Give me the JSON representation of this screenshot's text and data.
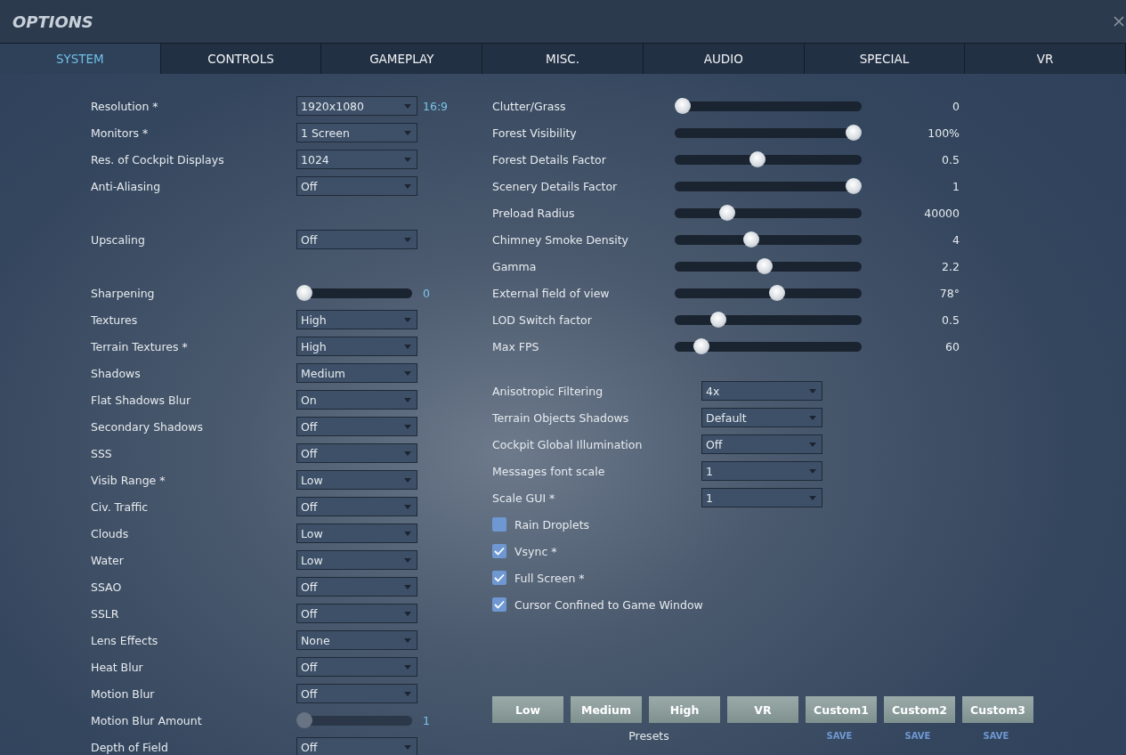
{
  "window": {
    "title": "OPTIONS"
  },
  "tabs": [
    {
      "label": "SYSTEM",
      "selected": true
    },
    {
      "label": "CONTROLS",
      "selected": false
    },
    {
      "label": "GAMEPLAY",
      "selected": false
    },
    {
      "label": "MISC.",
      "selected": false
    },
    {
      "label": "AUDIO",
      "selected": false
    },
    {
      "label": "SPECIAL",
      "selected": false
    },
    {
      "label": "VR",
      "selected": false
    }
  ],
  "left_settings": [
    {
      "kind": "dropdown",
      "label": "Resolution *",
      "value": "1920x1080",
      "note": "16:9"
    },
    {
      "kind": "dropdown",
      "label": "Monitors *",
      "value": "1 Screen"
    },
    {
      "kind": "dropdown",
      "label": "Res. of Cockpit Displays",
      "value": "1024"
    },
    {
      "kind": "dropdown",
      "label": "Anti-Aliasing",
      "value": "Off"
    },
    {
      "kind": "spacer"
    },
    {
      "kind": "dropdown",
      "label": "Upscaling",
      "value": "Off"
    },
    {
      "kind": "spacer"
    },
    {
      "kind": "slider",
      "label": "Sharpening",
      "level": 0,
      "reading": "0",
      "disabled": false
    },
    {
      "kind": "dropdown",
      "label": "Textures",
      "value": "High"
    },
    {
      "kind": "dropdown",
      "label": "Terrain Textures *",
      "value": "High"
    },
    {
      "kind": "dropdown",
      "label": "Shadows",
      "value": "Medium"
    },
    {
      "kind": "dropdown",
      "label": "Flat Shadows Blur",
      "value": "On"
    },
    {
      "kind": "dropdown",
      "label": "Secondary Shadows",
      "value": "Off"
    },
    {
      "kind": "dropdown",
      "label": "SSS",
      "value": "Off"
    },
    {
      "kind": "dropdown",
      "label": "Visib Range *",
      "value": "Low"
    },
    {
      "kind": "dropdown",
      "label": "Civ. Traffic",
      "value": "Off"
    },
    {
      "kind": "dropdown",
      "label": "Clouds",
      "value": "Low"
    },
    {
      "kind": "dropdown",
      "label": "Water",
      "value": "Low"
    },
    {
      "kind": "dropdown",
      "label": "SSAO",
      "value": "Off"
    },
    {
      "kind": "dropdown",
      "label": "SSLR",
      "value": "Off"
    },
    {
      "kind": "dropdown",
      "label": "Lens Effects",
      "value": "None"
    },
    {
      "kind": "dropdown",
      "label": "Heat Blur",
      "value": "Off"
    },
    {
      "kind": "dropdown",
      "label": "Motion Blur",
      "value": "Off"
    },
    {
      "kind": "slider",
      "label": "Motion Blur Amount",
      "level": 0,
      "reading": "1",
      "disabled": true
    },
    {
      "kind": "dropdown",
      "label": "Depth of Field",
      "value": "Off"
    }
  ],
  "right_sliders": [
    {
      "label": "Clutter/Grass",
      "level": 0,
      "reading": "0"
    },
    {
      "label": "Forest Visibility",
      "level": 1,
      "reading": "100%"
    },
    {
      "label": "Forest Details Factor",
      "level": 0.44,
      "reading": "0.5"
    },
    {
      "label": "Scenery Details Factor",
      "level": 1,
      "reading": "1"
    },
    {
      "label": "Preload Radius",
      "level": 0.26,
      "reading": "40000"
    },
    {
      "label": "Chimney Smoke Density",
      "level": 0.4,
      "reading": "4"
    },
    {
      "label": "Gamma",
      "level": 0.48,
      "reading": "2.2"
    },
    {
      "label": "External field of view",
      "level": 0.55,
      "reading": "78°"
    },
    {
      "label": "LOD Switch factor",
      "level": 0.21,
      "reading": "0.5"
    },
    {
      "label": "Max FPS",
      "level": 0.11,
      "reading": "60"
    }
  ],
  "right_dropdowns": [
    {
      "label": "Anisotropic Filtering",
      "value": "4x"
    },
    {
      "label": "Terrain Objects Shadows",
      "value": "Default"
    },
    {
      "label": "Cockpit Global Illumination",
      "value": "Off"
    },
    {
      "label": "Messages font scale",
      "value": "1"
    },
    {
      "label": "Scale GUI *",
      "value": "1"
    }
  ],
  "checkboxes": [
    {
      "label": "Rain Droplets",
      "checked": false
    },
    {
      "label": "Vsync *",
      "checked": true
    },
    {
      "label": "Full Screen *",
      "checked": true
    },
    {
      "label": "Cursor Confined to Game Window",
      "checked": true
    }
  ],
  "presets": {
    "label": "Presets",
    "buttons": [
      {
        "label": "Low"
      },
      {
        "label": "Medium"
      },
      {
        "label": "High"
      },
      {
        "label": "VR"
      },
      {
        "label": "Custom1",
        "save": "SAVE"
      },
      {
        "label": "Custom2",
        "save": "SAVE"
      },
      {
        "label": "Custom3",
        "save": "SAVE"
      }
    ]
  }
}
